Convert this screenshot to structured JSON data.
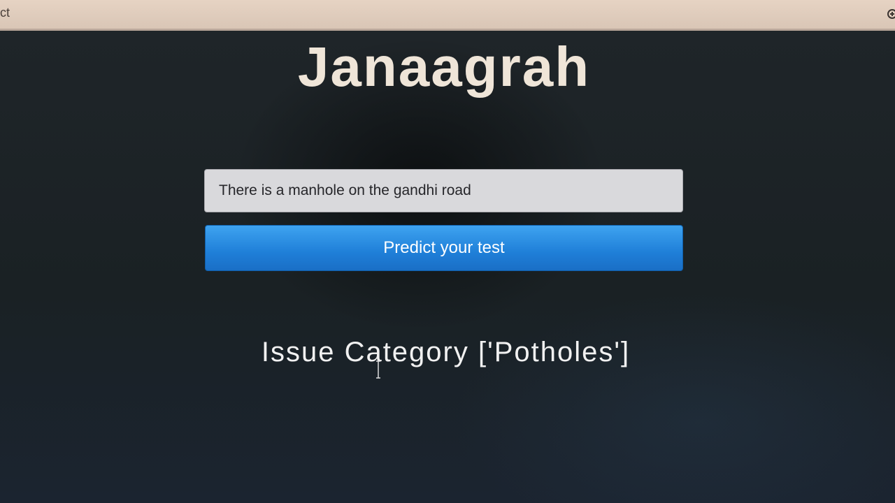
{
  "browser": {
    "tab_title": "ct",
    "zoom_icon": "zoom-in-icon"
  },
  "header": {
    "title": "Janaagrah"
  },
  "form": {
    "text_value": "There is a manhole on the gandhi road",
    "predict_label": "Predict your test"
  },
  "result": {
    "text": "Issue Category ['Potholes']"
  },
  "colors": {
    "button": "#1f7fd8",
    "background": "#1c2226",
    "title": "#efe5d8"
  }
}
